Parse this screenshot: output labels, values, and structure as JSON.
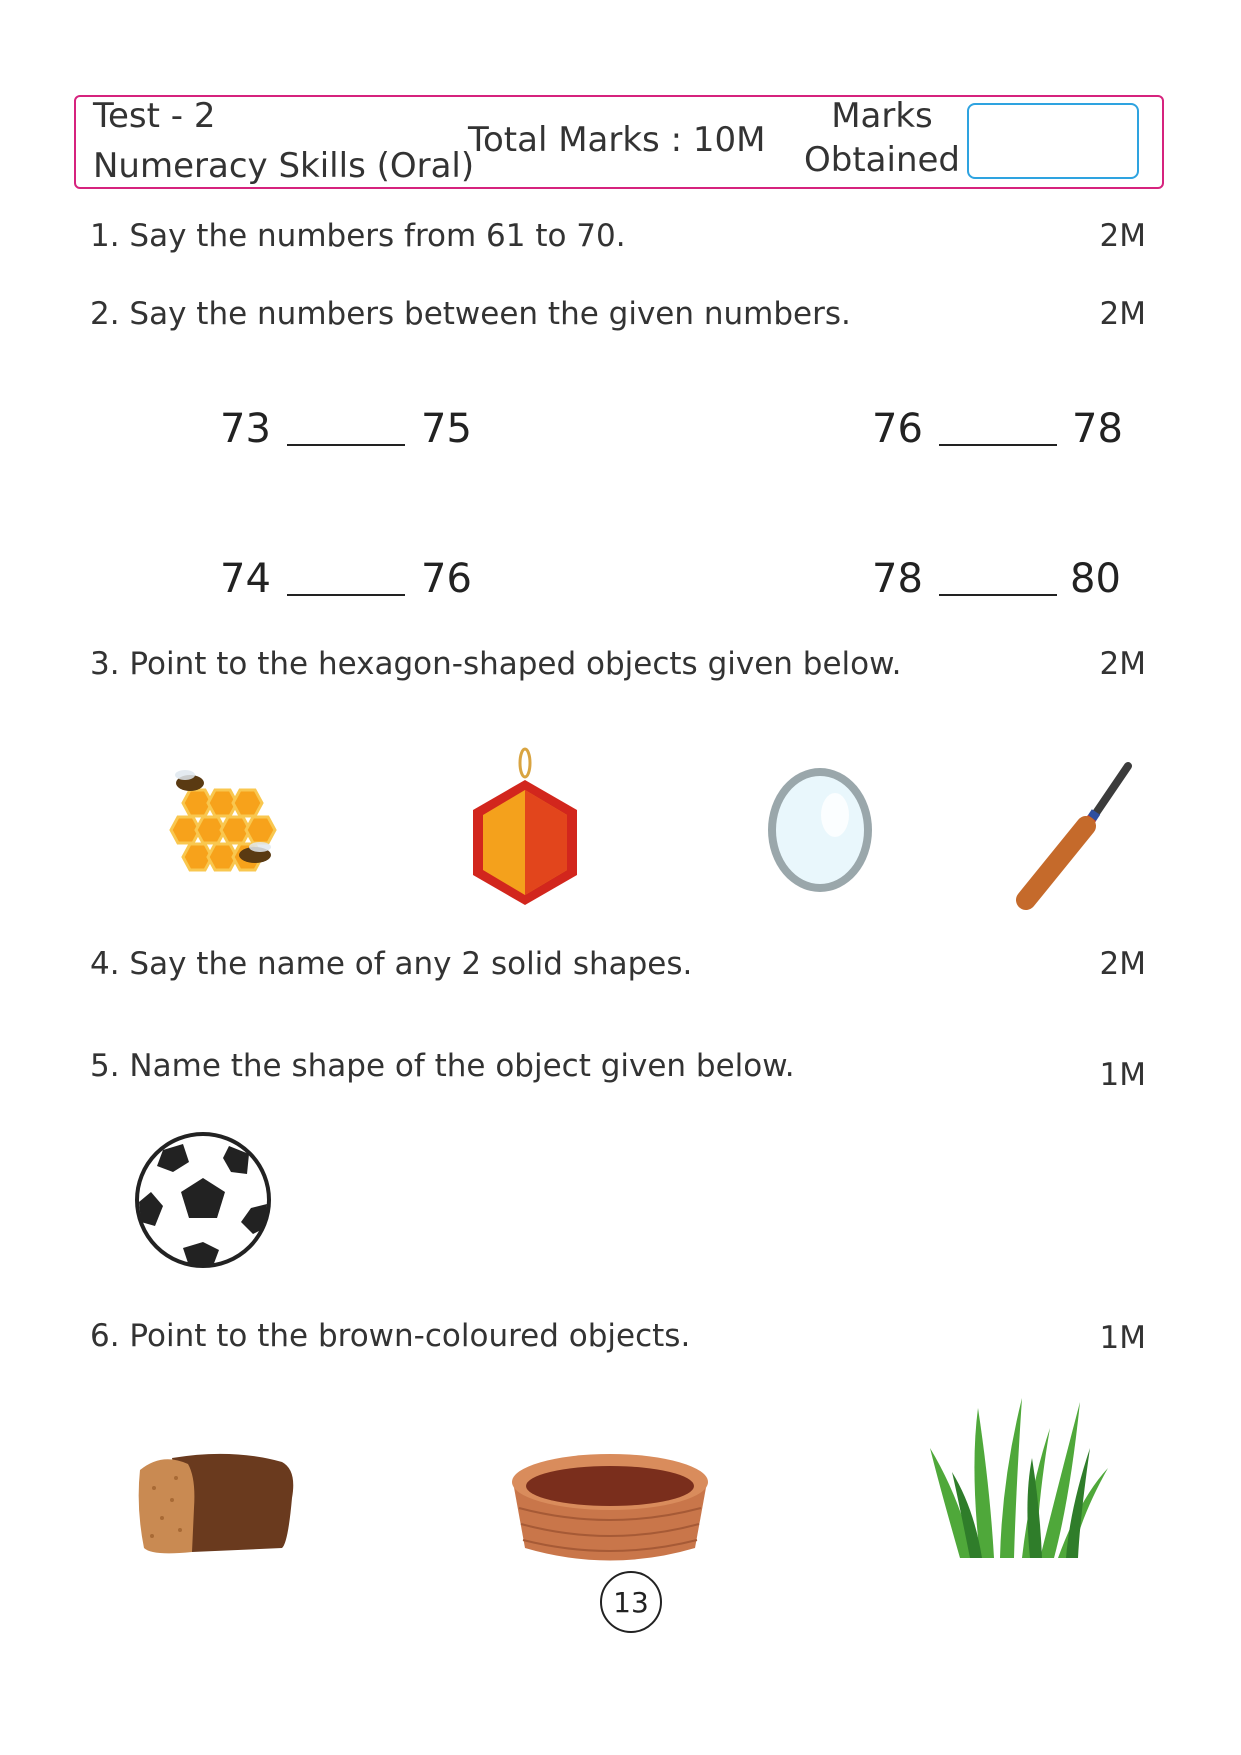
{
  "header": {
    "test_title": "Test - 2",
    "subject": "Numeracy Skills (Oral)",
    "total_marks": "Total Marks : 10M",
    "marks_label_1": "Marks",
    "marks_label_2": "Obtained"
  },
  "questions": [
    {
      "text": "1. Say the numbers from 61 to 70.",
      "marks": "2M"
    },
    {
      "text": "2. Say the numbers between the given numbers.",
      "marks": "2M"
    },
    {
      "text": "3. Point to the hexagon-shaped objects given below.",
      "marks": "2M"
    },
    {
      "text": "4. Say the name of any 2 solid shapes.",
      "marks": "2M"
    },
    {
      "text": "5. Name the shape of the object given below.",
      "marks": "1M"
    },
    {
      "text": "6. Point to the brown-coloured objects.",
      "marks": "1M"
    }
  ],
  "number_pairs": [
    {
      "left": "73",
      "right": "75"
    },
    {
      "left": "76",
      "right": "78"
    },
    {
      "left": "74",
      "right": "76"
    },
    {
      "left": "78",
      "right": "80"
    }
  ],
  "q3_images": [
    "honeycomb-with-bees",
    "hexagon-ornament",
    "round-mirror",
    "cricket-bat"
  ],
  "q5_images": [
    "football"
  ],
  "q6_images": [
    "bread-loaf",
    "wicker-basket",
    "grass"
  ],
  "page_number": "13",
  "colors": {
    "header_border": "#d6237e",
    "marks_box_border": "#2ea3e0"
  }
}
